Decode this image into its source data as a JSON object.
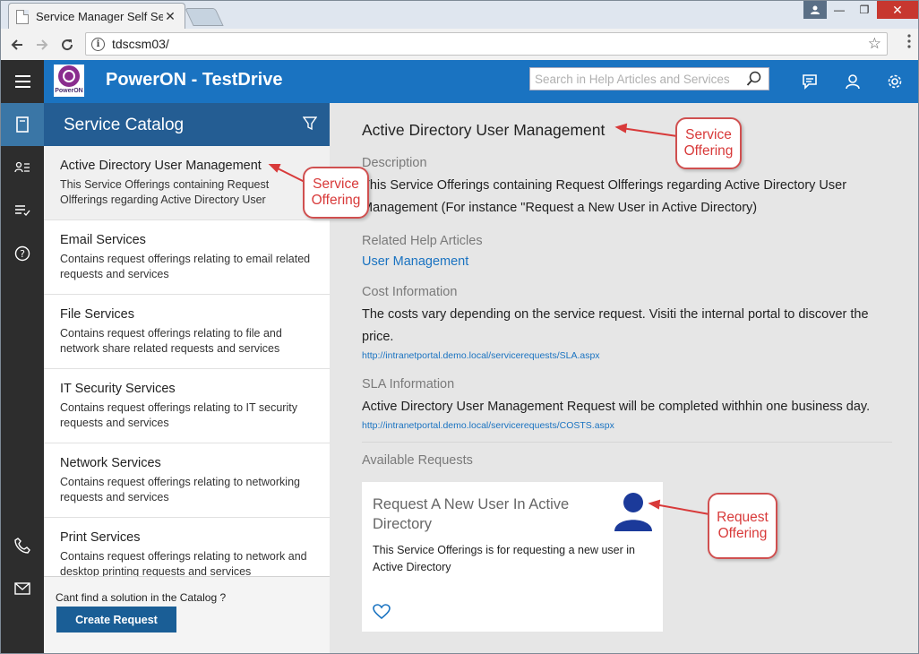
{
  "browser": {
    "tab_title": "Service Manager Self Ser",
    "tab_close": "✕",
    "url": "tdscsm03/",
    "window_buttons": {
      "minimize": "—",
      "restore": "❐",
      "close": "✕"
    }
  },
  "app": {
    "logo_text": "PowerON",
    "title": "PowerON - TestDrive",
    "search_placeholder": "Search in Help Articles and Services"
  },
  "catalog": {
    "title": "Service Catalog",
    "items": [
      {
        "title": "Active Directory User Management",
        "desc": "This Service Offerings containing Request Olfferings regarding Active Directory User"
      },
      {
        "title": "Email Services",
        "desc": "Contains request offerings relating to email related requests and services"
      },
      {
        "title": "File Services",
        "desc": "Contains request offerings relating to file and network share related requests and services"
      },
      {
        "title": "IT Security Services",
        "desc": "Contains request offerings relating to IT security requests and services"
      },
      {
        "title": "Network Services",
        "desc": "Contains request offerings relating to networking requests and services"
      },
      {
        "title": "Print Services",
        "desc": "Contains request offerings relating to network and desktop printing requests and services"
      }
    ],
    "footer_text": "Cant find a solution in the Catalog ?",
    "create_button": "Create Request"
  },
  "detail": {
    "title": "Active Directory User Management",
    "description_label": "Description",
    "description": "This Service Offerings containing Request Olfferings regarding Active Directory User Management (For instance \"Request a New User in Active Directory)",
    "help_label": "Related Help Articles",
    "help_link": "User Management",
    "cost_label": "Cost Information",
    "cost_text": "The costs vary depending on the service request. Visiti the internal portal to discover the price.",
    "cost_url": "http://intranetportal.demo.local/servicerequests/SLA.aspx",
    "sla_label": "SLA Information",
    "sla_text": "Active Directory User Management Request will be completed withhin one business day.",
    "sla_url": "http://intranetportal.demo.local/servicerequests/COSTS.aspx",
    "available_label": "Available Requests",
    "request_card": {
      "title": "Request A New User In Active Directory",
      "desc": "This Service Offerings is for requesting a new user in Active Directory"
    }
  },
  "callouts": {
    "catalog": "Service Offering",
    "detail": "Service Offering",
    "request": "Request Offering"
  },
  "colors": {
    "app_blue": "#1a73c1",
    "catalog_header": "#245d93",
    "rail": "#2d2d2d",
    "callout_red": "#d83a3a"
  }
}
